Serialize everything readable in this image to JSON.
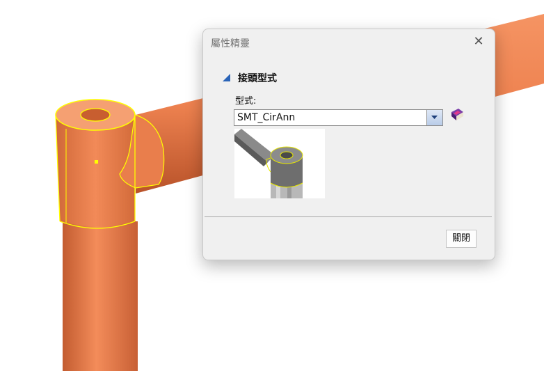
{
  "dialog": {
    "title": "屬性精靈",
    "close_glyph": "✕",
    "section_label": "接頭型式",
    "field_label": "型式:",
    "type_value": "SMT_CirAnn",
    "close_button_label": "關閉"
  },
  "icons": {
    "section": "triangle-bullet-icon",
    "dropdown": "chevron-down-icon",
    "help": "book-icon",
    "close": "close-icon"
  },
  "colors": {
    "pipe": "#f08654",
    "selection": "#ffff00",
    "accent": "#2a64b8"
  }
}
